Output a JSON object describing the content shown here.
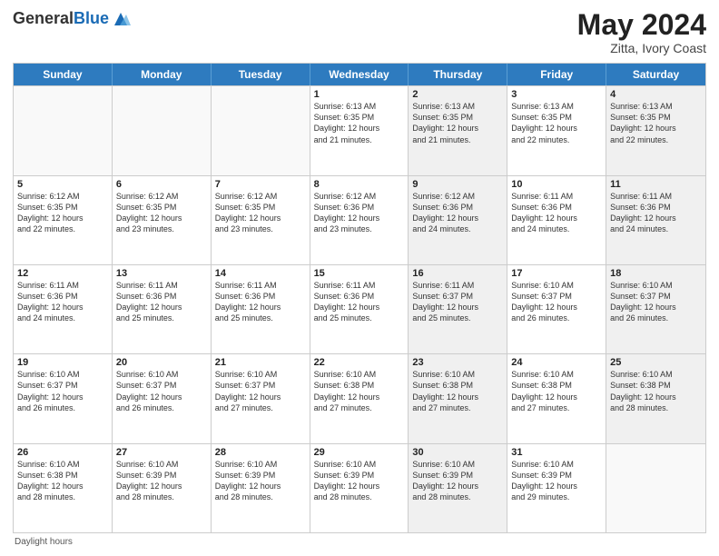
{
  "header": {
    "title": "May 2024",
    "location": "Zitta, Ivory Coast",
    "logo_general": "General",
    "logo_blue": "Blue"
  },
  "calendar": {
    "days_of_week": [
      "Sunday",
      "Monday",
      "Tuesday",
      "Wednesday",
      "Thursday",
      "Friday",
      "Saturday"
    ],
    "footnote": "Daylight hours",
    "rows": [
      [
        {
          "day": "",
          "info": "",
          "shaded": false,
          "empty": true
        },
        {
          "day": "",
          "info": "",
          "shaded": false,
          "empty": true
        },
        {
          "day": "",
          "info": "",
          "shaded": false,
          "empty": true
        },
        {
          "day": "1",
          "info": "Sunrise: 6:13 AM\nSunset: 6:35 PM\nDaylight: 12 hours\nand 21 minutes.",
          "shaded": false,
          "empty": false
        },
        {
          "day": "2",
          "info": "Sunrise: 6:13 AM\nSunset: 6:35 PM\nDaylight: 12 hours\nand 21 minutes.",
          "shaded": true,
          "empty": false
        },
        {
          "day": "3",
          "info": "Sunrise: 6:13 AM\nSunset: 6:35 PM\nDaylight: 12 hours\nand 22 minutes.",
          "shaded": false,
          "empty": false
        },
        {
          "day": "4",
          "info": "Sunrise: 6:13 AM\nSunset: 6:35 PM\nDaylight: 12 hours\nand 22 minutes.",
          "shaded": true,
          "empty": false
        }
      ],
      [
        {
          "day": "5",
          "info": "Sunrise: 6:12 AM\nSunset: 6:35 PM\nDaylight: 12 hours\nand 22 minutes.",
          "shaded": false,
          "empty": false
        },
        {
          "day": "6",
          "info": "Sunrise: 6:12 AM\nSunset: 6:35 PM\nDaylight: 12 hours\nand 23 minutes.",
          "shaded": false,
          "empty": false
        },
        {
          "day": "7",
          "info": "Sunrise: 6:12 AM\nSunset: 6:35 PM\nDaylight: 12 hours\nand 23 minutes.",
          "shaded": false,
          "empty": false
        },
        {
          "day": "8",
          "info": "Sunrise: 6:12 AM\nSunset: 6:36 PM\nDaylight: 12 hours\nand 23 minutes.",
          "shaded": false,
          "empty": false
        },
        {
          "day": "9",
          "info": "Sunrise: 6:12 AM\nSunset: 6:36 PM\nDaylight: 12 hours\nand 24 minutes.",
          "shaded": true,
          "empty": false
        },
        {
          "day": "10",
          "info": "Sunrise: 6:11 AM\nSunset: 6:36 PM\nDaylight: 12 hours\nand 24 minutes.",
          "shaded": false,
          "empty": false
        },
        {
          "day": "11",
          "info": "Sunrise: 6:11 AM\nSunset: 6:36 PM\nDaylight: 12 hours\nand 24 minutes.",
          "shaded": true,
          "empty": false
        }
      ],
      [
        {
          "day": "12",
          "info": "Sunrise: 6:11 AM\nSunset: 6:36 PM\nDaylight: 12 hours\nand 24 minutes.",
          "shaded": false,
          "empty": false
        },
        {
          "day": "13",
          "info": "Sunrise: 6:11 AM\nSunset: 6:36 PM\nDaylight: 12 hours\nand 25 minutes.",
          "shaded": false,
          "empty": false
        },
        {
          "day": "14",
          "info": "Sunrise: 6:11 AM\nSunset: 6:36 PM\nDaylight: 12 hours\nand 25 minutes.",
          "shaded": false,
          "empty": false
        },
        {
          "day": "15",
          "info": "Sunrise: 6:11 AM\nSunset: 6:36 PM\nDaylight: 12 hours\nand 25 minutes.",
          "shaded": false,
          "empty": false
        },
        {
          "day": "16",
          "info": "Sunrise: 6:11 AM\nSunset: 6:37 PM\nDaylight: 12 hours\nand 25 minutes.",
          "shaded": true,
          "empty": false
        },
        {
          "day": "17",
          "info": "Sunrise: 6:10 AM\nSunset: 6:37 PM\nDaylight: 12 hours\nand 26 minutes.",
          "shaded": false,
          "empty": false
        },
        {
          "day": "18",
          "info": "Sunrise: 6:10 AM\nSunset: 6:37 PM\nDaylight: 12 hours\nand 26 minutes.",
          "shaded": true,
          "empty": false
        }
      ],
      [
        {
          "day": "19",
          "info": "Sunrise: 6:10 AM\nSunset: 6:37 PM\nDaylight: 12 hours\nand 26 minutes.",
          "shaded": false,
          "empty": false
        },
        {
          "day": "20",
          "info": "Sunrise: 6:10 AM\nSunset: 6:37 PM\nDaylight: 12 hours\nand 26 minutes.",
          "shaded": false,
          "empty": false
        },
        {
          "day": "21",
          "info": "Sunrise: 6:10 AM\nSunset: 6:37 PM\nDaylight: 12 hours\nand 27 minutes.",
          "shaded": false,
          "empty": false
        },
        {
          "day": "22",
          "info": "Sunrise: 6:10 AM\nSunset: 6:38 PM\nDaylight: 12 hours\nand 27 minutes.",
          "shaded": false,
          "empty": false
        },
        {
          "day": "23",
          "info": "Sunrise: 6:10 AM\nSunset: 6:38 PM\nDaylight: 12 hours\nand 27 minutes.",
          "shaded": true,
          "empty": false
        },
        {
          "day": "24",
          "info": "Sunrise: 6:10 AM\nSunset: 6:38 PM\nDaylight: 12 hours\nand 27 minutes.",
          "shaded": false,
          "empty": false
        },
        {
          "day": "25",
          "info": "Sunrise: 6:10 AM\nSunset: 6:38 PM\nDaylight: 12 hours\nand 28 minutes.",
          "shaded": true,
          "empty": false
        }
      ],
      [
        {
          "day": "26",
          "info": "Sunrise: 6:10 AM\nSunset: 6:38 PM\nDaylight: 12 hours\nand 28 minutes.",
          "shaded": false,
          "empty": false
        },
        {
          "day": "27",
          "info": "Sunrise: 6:10 AM\nSunset: 6:39 PM\nDaylight: 12 hours\nand 28 minutes.",
          "shaded": false,
          "empty": false
        },
        {
          "day": "28",
          "info": "Sunrise: 6:10 AM\nSunset: 6:39 PM\nDaylight: 12 hours\nand 28 minutes.",
          "shaded": false,
          "empty": false
        },
        {
          "day": "29",
          "info": "Sunrise: 6:10 AM\nSunset: 6:39 PM\nDaylight: 12 hours\nand 28 minutes.",
          "shaded": false,
          "empty": false
        },
        {
          "day": "30",
          "info": "Sunrise: 6:10 AM\nSunset: 6:39 PM\nDaylight: 12 hours\nand 28 minutes.",
          "shaded": true,
          "empty": false
        },
        {
          "day": "31",
          "info": "Sunrise: 6:10 AM\nSunset: 6:39 PM\nDaylight: 12 hours\nand 29 minutes.",
          "shaded": false,
          "empty": false
        },
        {
          "day": "",
          "info": "",
          "shaded": true,
          "empty": true
        }
      ]
    ]
  }
}
